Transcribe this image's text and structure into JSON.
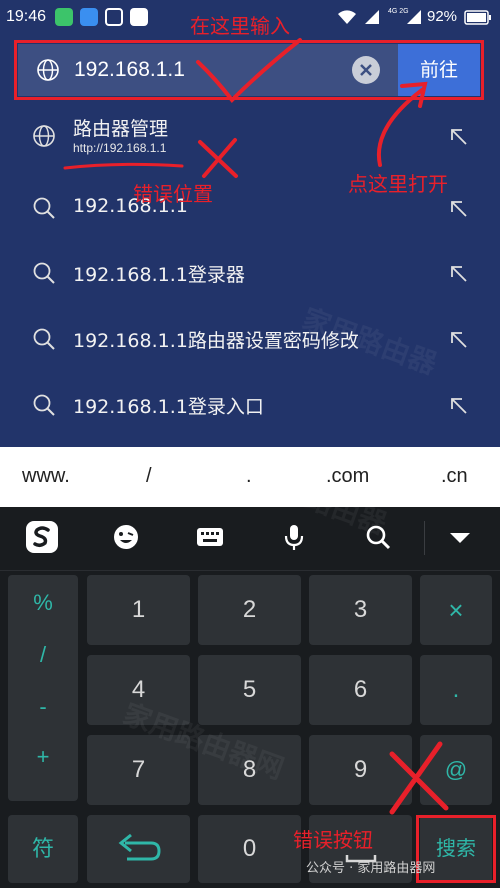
{
  "status_bar": {
    "time": "19:46",
    "network": "4G 2G",
    "battery": "92%"
  },
  "search_bar": {
    "url_value": "192.168.1.1",
    "go_label": "前往"
  },
  "suggestions": [
    {
      "icon": "globe-icon",
      "title": "路由器管理",
      "subtitle": "http://192.168.1.1"
    },
    {
      "icon": "search-icon",
      "text": "192.168.1.1"
    },
    {
      "icon": "search-icon",
      "text": "192.168.1.1登录器"
    },
    {
      "icon": "search-icon",
      "text": "192.168.1.1路由器设置密码修改"
    },
    {
      "icon": "search-icon",
      "text": "192.168.1.1登录入口"
    }
  ],
  "shortcuts": [
    "www.",
    "/",
    ".",
    ".com",
    ".cn"
  ],
  "keyboard": {
    "side_keys": [
      "%",
      "/",
      "-",
      "+"
    ],
    "digits": [
      "1",
      "2",
      "3",
      "4",
      "5",
      "6",
      "7",
      "8",
      "9",
      "0"
    ],
    "right_keys": [
      "×",
      ".",
      "@"
    ],
    "bottom": {
      "symbol": "符",
      "search": "搜索"
    }
  },
  "annotations": {
    "input_here": "在这里输入",
    "click_here": "点这里打开",
    "wrong_position": "错误位置",
    "wrong_button": "错误按钮"
  },
  "watermark": "公众号 · 家用路由器网",
  "colors": {
    "top_bg": "#22346a",
    "search_field": "#3d4f82",
    "go_button": "#3d6fd8",
    "annotation_red": "#e8202a",
    "keyboard_bg": "#191c1f",
    "key_bg": "#2e3236",
    "accent_teal": "#2fb7a8"
  }
}
